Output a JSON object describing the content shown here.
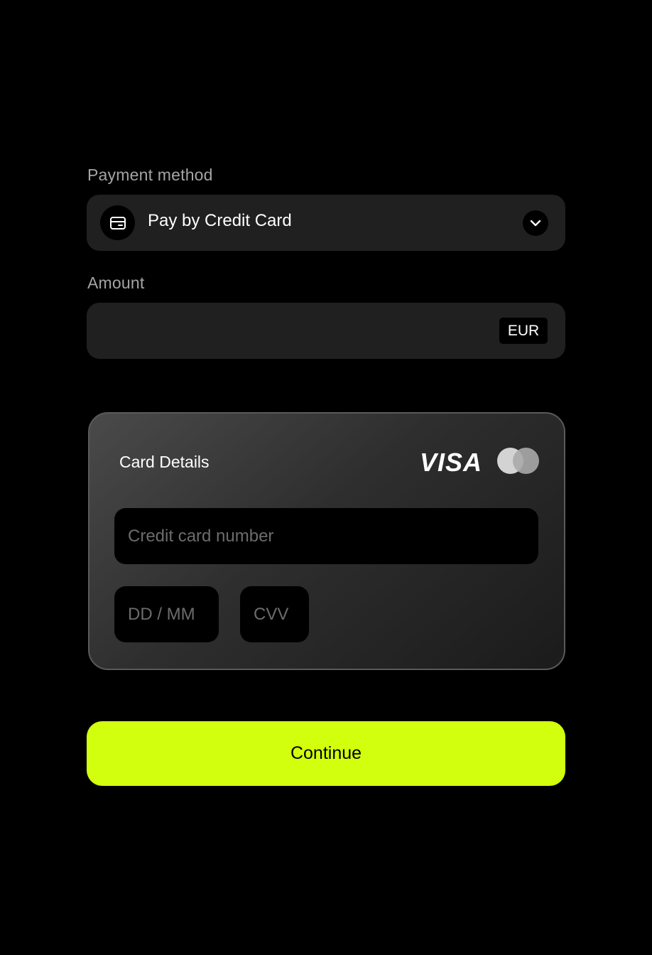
{
  "payment_method": {
    "label": "Payment method",
    "selected_value": "Pay by Credit Card",
    "icon": "credit-card-icon"
  },
  "amount": {
    "label": "Amount",
    "value": "",
    "currency": "EUR"
  },
  "card_details": {
    "title": "Card Details",
    "brands": [
      "VISA",
      "mastercard"
    ],
    "visa_text": "VISA",
    "number_placeholder": "Credit card number",
    "date_placeholder": "DD / MM",
    "cvv_placeholder": "CVV"
  },
  "actions": {
    "continue_label": "Continue"
  },
  "colors": {
    "background": "#000000",
    "field": "#202020",
    "accent": "#d2ff0d"
  }
}
